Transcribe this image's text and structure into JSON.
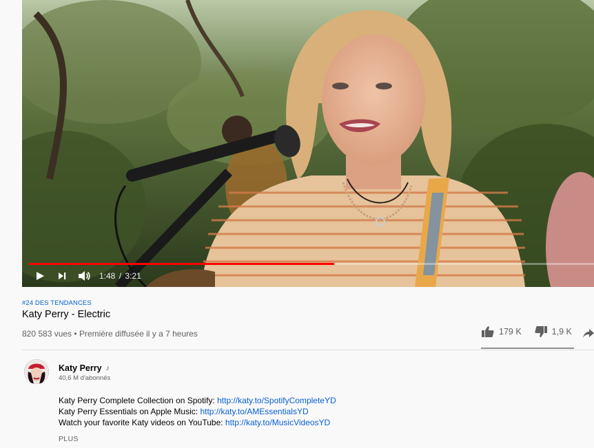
{
  "player": {
    "time_current": "1:48",
    "time_separator": "/",
    "time_total": "3:21",
    "progress_fraction": 0.54,
    "icons": [
      "play-icon",
      "next-icon",
      "volume-icon"
    ]
  },
  "video": {
    "hashtag": "#24 DES TENDANCES",
    "title": "Katy Perry - Electric",
    "views": "820 583 vues",
    "meta_separator": " • ",
    "premiere": "Première diffusée il y a 7 heures",
    "likes": "179 K",
    "dislikes": "1,9 K",
    "like_ratio": 0.99
  },
  "channel": {
    "name": "Katy Perry",
    "subscribers": "40,6 M d'abonnés"
  },
  "description": {
    "lines": [
      {
        "text": "Katy Perry Complete Collection on Spotify: ",
        "link": "http://katy.to/SpotifyCompleteYD"
      },
      {
        "text": "Katy Perry Essentials on Apple Music: ",
        "link": "http://katy.to/AMEssentialsYD"
      },
      {
        "text": "Watch your favorite Katy videos on YouTube: ",
        "link": "http://katy.to/MusicVideosYD"
      }
    ],
    "more_label": "PLUS"
  },
  "colors": {
    "accent_red": "#ff0000",
    "link_blue": "#065fd4",
    "text_secondary": "#606060"
  }
}
